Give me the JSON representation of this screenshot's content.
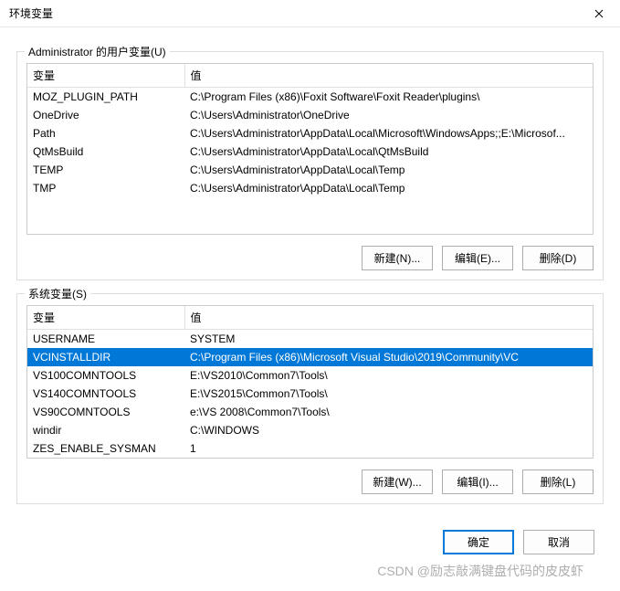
{
  "window": {
    "title": "环境变量"
  },
  "userSection": {
    "label": "Administrator 的用户变量(U)",
    "headers": {
      "name": "变量",
      "value": "值"
    },
    "rows": [
      {
        "name": "MOZ_PLUGIN_PATH",
        "value": "C:\\Program Files (x86)\\Foxit Software\\Foxit Reader\\plugins\\"
      },
      {
        "name": "OneDrive",
        "value": "C:\\Users\\Administrator\\OneDrive"
      },
      {
        "name": "Path",
        "value": "C:\\Users\\Administrator\\AppData\\Local\\Microsoft\\WindowsApps;;E:\\Microsof..."
      },
      {
        "name": "QtMsBuild",
        "value": "C:\\Users\\Administrator\\AppData\\Local\\QtMsBuild"
      },
      {
        "name": "TEMP",
        "value": "C:\\Users\\Administrator\\AppData\\Local\\Temp"
      },
      {
        "name": "TMP",
        "value": "C:\\Users\\Administrator\\AppData\\Local\\Temp"
      }
    ],
    "buttons": {
      "new": "新建(N)...",
      "edit": "编辑(E)...",
      "delete": "删除(D)"
    }
  },
  "systemSection": {
    "label": "系统变量(S)",
    "headers": {
      "name": "变量",
      "value": "值"
    },
    "rows": [
      {
        "name": "USERNAME",
        "value": "SYSTEM",
        "selected": false
      },
      {
        "name": "VCINSTALLDIR",
        "value": "C:\\Program Files (x86)\\Microsoft Visual Studio\\2019\\Community\\VC",
        "selected": true
      },
      {
        "name": "VS100COMNTOOLS",
        "value": "E:\\VS2010\\Common7\\Tools\\",
        "selected": false
      },
      {
        "name": "VS140COMNTOOLS",
        "value": "E:\\VS2015\\Common7\\Tools\\",
        "selected": false
      },
      {
        "name": "VS90COMNTOOLS",
        "value": "e:\\VS 2008\\Common7\\Tools\\",
        "selected": false
      },
      {
        "name": "windir",
        "value": "C:\\WINDOWS",
        "selected": false
      },
      {
        "name": "ZES_ENABLE_SYSMAN",
        "value": "1",
        "selected": false
      }
    ],
    "buttons": {
      "new": "新建(W)...",
      "edit": "编辑(I)...",
      "delete": "删除(L)"
    }
  },
  "dialog": {
    "ok": "确定",
    "cancel": "取消"
  },
  "watermark": "CSDN @励志敲满键盘代码的皮皮虾"
}
